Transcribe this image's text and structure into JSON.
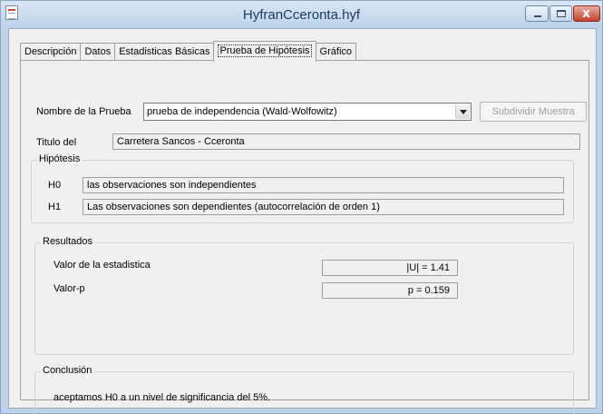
{
  "window": {
    "title": "HyfranCceronta.hyf",
    "close_glyph": "x"
  },
  "tabs": [
    {
      "label": "Descripción"
    },
    {
      "label": "Datos"
    },
    {
      "label": "Estadisticas Básicas"
    },
    {
      "label": "Prueba de Hipótesis"
    },
    {
      "label": "Gráfico"
    }
  ],
  "form": {
    "test_name_label": "Nombre de la Prueba",
    "test_name_value": "prueba de independencia (Wald-Wolfowitz)",
    "subdivide_button": "Subdividir Muestra",
    "title_label": "Titulo del",
    "title_value": "Carretera Sancos - Cceronta"
  },
  "hypotheses": {
    "legend": "Hipótesis",
    "h0_label": "H0",
    "h0_value": "las observaciones son independientes",
    "h1_label": "H1",
    "h1_value": "Las observaciones son dependientes (autocorrelación de orden 1)"
  },
  "results": {
    "legend": "Resultados",
    "stat_label": "Valor de la estadistica",
    "stat_value": "|U| =  1.41",
    "p_label": "Valor-p",
    "p_value": "p =  0.159"
  },
  "conclusion": {
    "legend": "Conclusión",
    "text": "aceptamos H0 a un nivel de significancia del 5%."
  }
}
